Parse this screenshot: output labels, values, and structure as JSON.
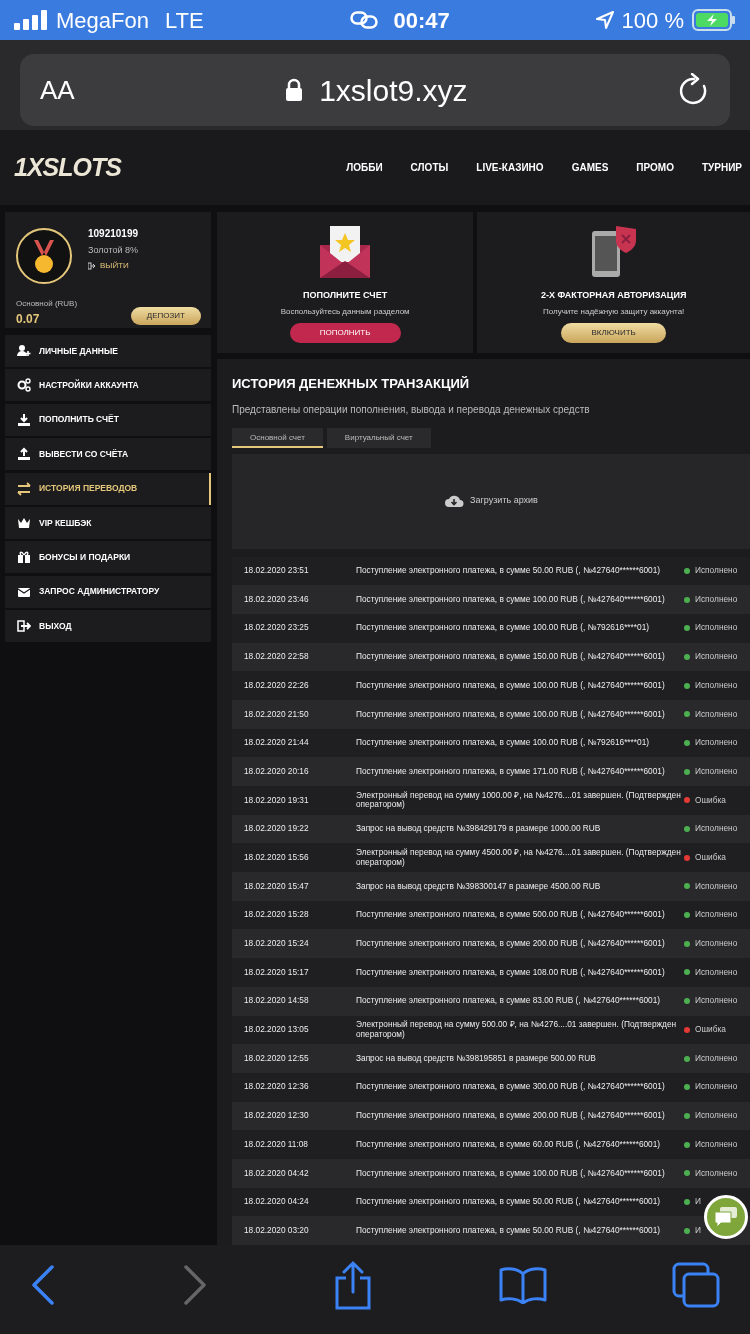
{
  "status_bar": {
    "carrier": "MegaFon",
    "network": "LTE",
    "time": "00:47",
    "battery": "100 %"
  },
  "address_bar": {
    "text_size": "AA",
    "url": "1xslot9.xyz"
  },
  "site": {
    "logo": "1XSLOTS",
    "nav": [
      "ЛОББИ",
      "СЛОТЫ",
      "LIVE-КАЗИНО",
      "GAMES",
      "ПРОМО",
      "ТУРНИР"
    ]
  },
  "profile": {
    "id": "109210199",
    "level": "Золотой 8%",
    "logout": "ВЫЙТИ",
    "balance_label": "Основной (RUB)",
    "balance": "0.07",
    "deposit": "ДЕПОЗИТ"
  },
  "sidebar": {
    "items": [
      {
        "label": "ЛИЧНЫЕ ДАННЫЕ",
        "selected": false
      },
      {
        "label": "НАСТРОЙКИ АККАУНТА",
        "selected": false
      },
      {
        "label": "ПОПОЛНИТЬ СЧЁТ",
        "selected": false
      },
      {
        "label": "ВЫВЕСТИ СО СЧЁТА",
        "selected": false
      },
      {
        "label": "ИСТОРИЯ ПЕРЕВОДОВ",
        "selected": true
      },
      {
        "label": "VIP КЕШБЭК",
        "selected": false
      },
      {
        "label": "БОНУСЫ И ПОДАРКИ",
        "selected": false
      },
      {
        "label": "ЗАПРОС АДМИНИСТРАТОРУ",
        "selected": false
      },
      {
        "label": "ВЫХОД",
        "selected": false
      }
    ]
  },
  "promo_cards": [
    {
      "title": "ПОПОЛНИТЕ СЧЕТ",
      "text": "Воспользуйтесь данным разделом",
      "button": "ПОПОЛНИТЬ",
      "kind": "red"
    },
    {
      "title": "2-Х ФАКТОРНАЯ АВТОРИЗАЦИЯ",
      "text": "Получите надёжную защиту аккаунта!",
      "button": "ВКЛЮЧИТЬ",
      "kind": "gold"
    }
  ],
  "history": {
    "title": "ИСТОРИЯ ДЕНЕЖНЫХ ТРАНЗАКЦИЙ",
    "subtitle": "Представлены операции пополнения, вывода и перевода денежных средств",
    "tabs": [
      {
        "label": "Основной счет",
        "selected": true
      },
      {
        "label": "Виртуальный счет",
        "selected": false
      }
    ],
    "archive": "Загрузить архив",
    "rows": [
      {
        "date": "18.02.2020 23:51",
        "text": "Поступление электронного платежа, в сумме 50.00 RUB (, №427640******6001)",
        "status": "Исполнено",
        "color": "#4caf50"
      },
      {
        "date": "18.02.2020 23:46",
        "text": "Поступление электронного платежа, в сумме 100.00 RUB (, №427640******6001)",
        "status": "Исполнено",
        "color": "#4caf50"
      },
      {
        "date": "18.02.2020 23:25",
        "text": "Поступление электронного платежа, в сумме 100.00 RUB (, №792616****01)",
        "status": "Исполнено",
        "color": "#4caf50"
      },
      {
        "date": "18.02.2020 22:58",
        "text": "Поступление электронного платежа, в сумме 150.00 RUB (, №427640******6001)",
        "status": "Исполнено",
        "color": "#4caf50"
      },
      {
        "date": "18.02.2020 22:26",
        "text": "Поступление электронного платежа, в сумме 100.00 RUB (, №427640******6001)",
        "status": "Исполнено",
        "color": "#4caf50"
      },
      {
        "date": "18.02.2020 21:50",
        "text": "Поступление электронного платежа, в сумме 100.00 RUB (, №427640******6001)",
        "status": "Исполнено",
        "color": "#4caf50"
      },
      {
        "date": "18.02.2020 21:44",
        "text": "Поступление электронного платежа, в сумме 100.00 RUB (, №792616****01)",
        "status": "Исполнено",
        "color": "#4caf50"
      },
      {
        "date": "18.02.2020 20:16",
        "text": "Поступление электронного платежа, в сумме 171.00 RUB (, №427640******6001)",
        "status": "Исполнено",
        "color": "#4caf50"
      },
      {
        "date": "18.02.2020 19:31",
        "text": "Электронный перевод на сумму 1000.00 ₽, на №4276....01 завершен. (Подтвержден оператором)",
        "status": "Ошибка",
        "color": "#e53935"
      },
      {
        "date": "18.02.2020 19:22",
        "text": "Запрос на вывод средств №398429179 в размере 1000.00 RUB",
        "status": "Исполнено",
        "color": "#4caf50"
      },
      {
        "date": "18.02.2020 15:56",
        "text": "Электронный перевод на сумму 4500.00 ₽, на №4276....01 завершен. (Подтвержден оператором)",
        "status": "Ошибка",
        "color": "#e53935"
      },
      {
        "date": "18.02.2020 15:47",
        "text": "Запрос на вывод средств №398300147 в размере 4500.00 RUB",
        "status": "Исполнено",
        "color": "#4caf50"
      },
      {
        "date": "18.02.2020 15:28",
        "text": "Поступление электронного платежа, в сумме 500.00 RUB (, №427640******6001)",
        "status": "Исполнено",
        "color": "#4caf50"
      },
      {
        "date": "18.02.2020 15:24",
        "text": "Поступление электронного платежа, в сумме 200.00 RUB (, №427640******6001)",
        "status": "Исполнено",
        "color": "#4caf50"
      },
      {
        "date": "18.02.2020 15:17",
        "text": "Поступление электронного платежа, в сумме 108.00 RUB (, №427640******6001)",
        "status": "Исполнено",
        "color": "#4caf50"
      },
      {
        "date": "18.02.2020 14:58",
        "text": "Поступление электронного платежа, в сумме 83.00 RUB (, №427640******6001)",
        "status": "Исполнено",
        "color": "#4caf50"
      },
      {
        "date": "18.02.2020 13:05",
        "text": "Электронный перевод на сумму 500.00 ₽, на №4276....01 завершен. (Подтвержден оператором)",
        "status": "Ошибка",
        "color": "#e53935"
      },
      {
        "date": "18.02.2020 12:55",
        "text": "Запрос на вывод средств №398195851 в размере 500.00 RUB",
        "status": "Исполнено",
        "color": "#4caf50"
      },
      {
        "date": "18.02.2020 12:36",
        "text": "Поступление электронного платежа, в сумме 300.00 RUB (, №427640******6001)",
        "status": "Исполнено",
        "color": "#4caf50"
      },
      {
        "date": "18.02.2020 12:30",
        "text": "Поступление электронного платежа, в сумме 200.00 RUB (, №427640******6001)",
        "status": "Исполнено",
        "color": "#4caf50"
      },
      {
        "date": "18.02.2020 11:08",
        "text": "Поступление электронного платежа, в сумме 60.00 RUB (, №427640******6001)",
        "status": "Исполнено",
        "color": "#4caf50"
      },
      {
        "date": "18.02.2020 04:42",
        "text": "Поступление электронного платежа, в сумме 100.00 RUB (, №427640******6001)",
        "status": "Исполнено",
        "color": "#4caf50"
      },
      {
        "date": "18.02.2020 04:24",
        "text": "Поступление электронного платежа, в сумме 50.00 RUB (, №427640******6001)",
        "status": "И",
        "color": "#4caf50"
      },
      {
        "date": "18.02.2020 03:20",
        "text": "Поступление электронного платежа, в сумме 50.00 RUB (, №427640******6001)",
        "status": "И",
        "color": "#4caf50"
      }
    ]
  }
}
